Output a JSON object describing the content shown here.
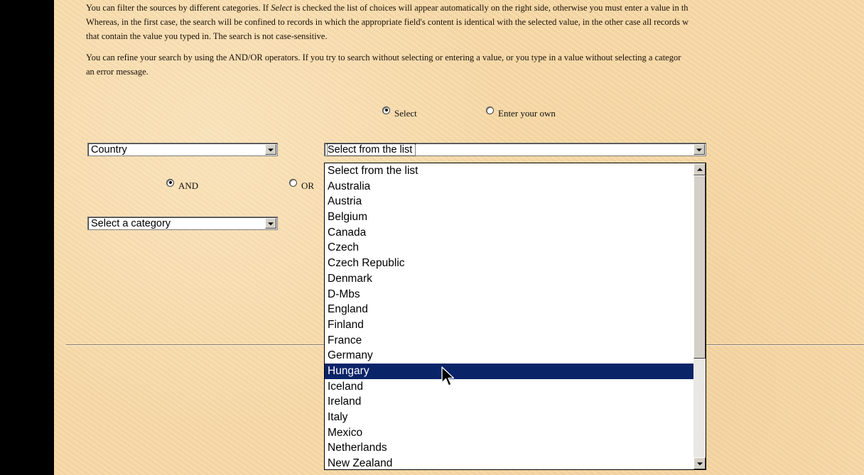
{
  "instructions": {
    "p1_lines": [
      {
        "before": "You can filter the sources by different categories. If ",
        "italic": "Select",
        "after": " is checked the list of choices will appear automatically on the right side, otherwise you must enter a value in th"
      },
      {
        "text": "Whereas, in the first case, the search will be confined to records in which the appropriate field's content is identical with the selected value, in the other case all records w"
      },
      {
        "text": "that contain the value you typed in. The search is not case-sensitive."
      }
    ],
    "p2_lines": [
      {
        "text": "You can refine your search by using the AND/OR operators. If you try to search without selecting or entering a value, or you type in a value without selecting a categor"
      },
      {
        "text": "an error message."
      }
    ]
  },
  "mode": {
    "select_label": "Select",
    "select_checked": true,
    "enter_own_label": "Enter your own",
    "enter_own_checked": false
  },
  "category1": {
    "value": "Country"
  },
  "operator": {
    "and_label": "AND",
    "and_checked": true,
    "or_label": "OR",
    "or_checked": false
  },
  "category2": {
    "value": "Select a category"
  },
  "value_select": {
    "value": "Select from the list",
    "options": [
      "Select from the list",
      "Australia",
      "Austria",
      "Belgium",
      "Canada",
      "Czech",
      "Czech Republic",
      "Denmark",
      "D-Mbs",
      "England",
      "Finland",
      "France",
      "Germany",
      "Hungary",
      "Iceland",
      "Ireland",
      "Italy",
      "Mexico",
      "Netherlands",
      "New Zealand"
    ],
    "highlighted": "Hungary"
  },
  "colors": {
    "page_background": "#f8d9a6",
    "highlight": "#0a2468"
  },
  "icons": {
    "dropdown_arrow": "chevron-down-icon",
    "scroll_up": "scroll-up-icon",
    "scroll_down": "scroll-down-icon",
    "mouse_cursor": "pointer-cursor-icon"
  }
}
